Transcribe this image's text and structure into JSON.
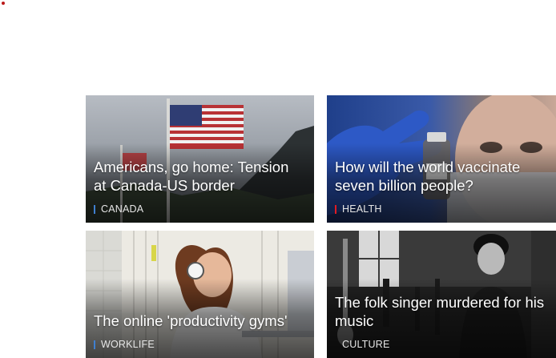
{
  "colors": {
    "brand_dot": "#bb1919",
    "canada_tag": "#3f7fcf",
    "health_tag": "#e11b22",
    "worklife_tag": "#3f7fcf",
    "culture_tag": "#e6e6e6"
  },
  "cards": [
    {
      "headline": "Americans, go home: Tension at Canada-US border",
      "tag": "CANADA",
      "image": "us-flag-mountains-image"
    },
    {
      "headline": "How will the world vaccinate seven billion people?",
      "tag": "HEALTH",
      "image": "vaccine-vial-gloved-hand-image"
    },
    {
      "headline": "The online 'productivity gyms'",
      "tag": "WORKLIFE",
      "image": "woman-headphones-laptop-image"
    },
    {
      "headline": "The folk singer murdered for his music",
      "tag": "CULTURE",
      "image": "folk-singer-portrait-image"
    }
  ]
}
